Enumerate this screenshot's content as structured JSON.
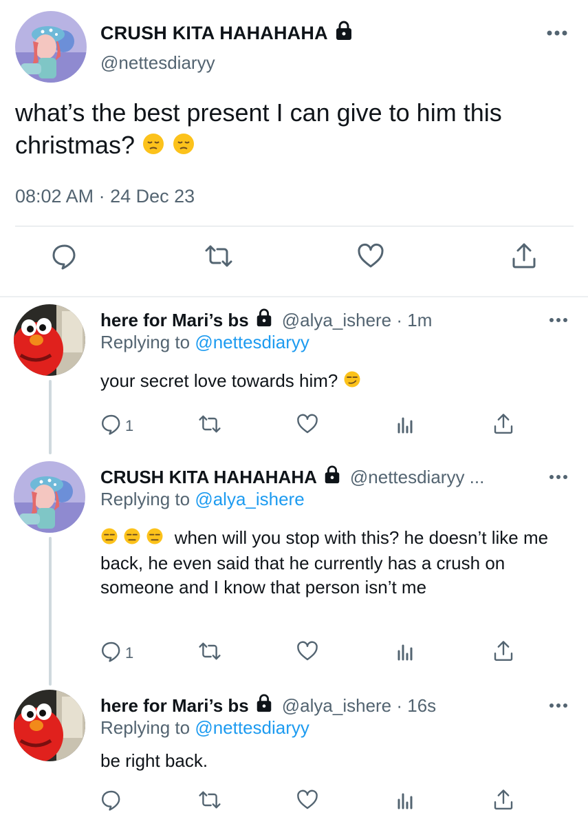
{
  "main_tweet": {
    "display_name": "CRUSH KITA HAHAHAHA",
    "handle": "@nettesdiaryy",
    "text": "what’s the best present I can give to him this christmas?",
    "emojis": [
      "pensive-face",
      "pensive-face"
    ],
    "timestamp": "08:02 AM · 24 Dec 23",
    "actions": [
      "reply-icon",
      "retweet-icon",
      "like-icon",
      "share-icon"
    ]
  },
  "replies": [
    {
      "display_name": "here for Mari’s bs",
      "handle": "@alya_ishere · 1m",
      "replying_prefix": "Replying to",
      "replying_to": "@nettesdiaryy",
      "text": "your secret love towards him?",
      "trailing_emoji": "smirking-face",
      "reply_count": "1"
    },
    {
      "display_name": "CRUSH KITA HAHAHAHA",
      "handle": "@nettesdiaryy ...",
      "replying_prefix": "Replying to",
      "replying_to": "@alya_ishere",
      "leading_emojis": [
        "expressionless-face",
        "expressionless-face",
        "expressionless-face"
      ],
      "text_line1": "when will you stop with this? he doesn’t",
      "text_rest": "like me back, he even said that he currently has a crush on someone and I know that person isn’t me",
      "reply_count": "1"
    },
    {
      "display_name": "here for Mari’s bs",
      "handle": "@alya_ishere · 16s",
      "replying_prefix": "Replying to",
      "replying_to": "@nettesdiaryy",
      "text": "be right back.",
      "reply_count": ""
    }
  ],
  "colors": {
    "text": "#0f1419",
    "secondary": "#536471",
    "link": "#1d9bf0",
    "divider": "#d9dee2",
    "thread_line": "#cfd9de"
  }
}
